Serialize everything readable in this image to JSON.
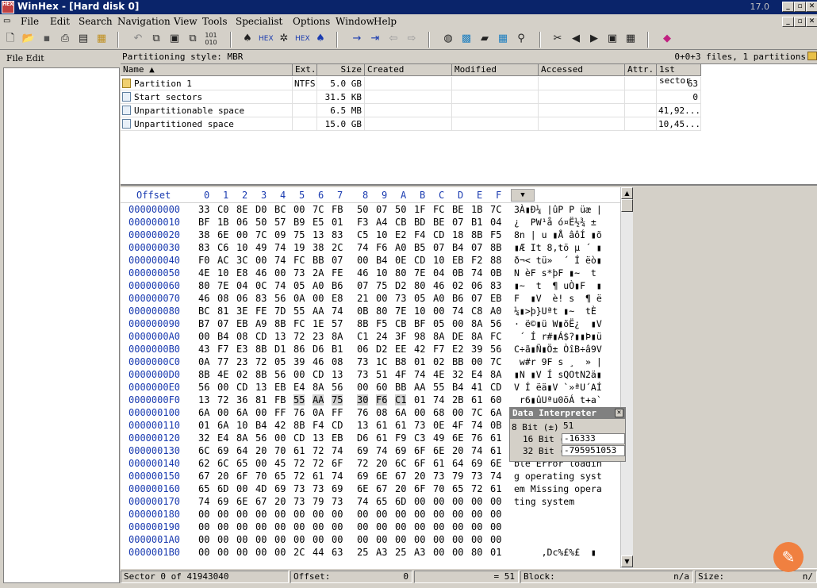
{
  "window": {
    "title": "WinHex - [Hard disk 0]",
    "version": "17.0"
  },
  "menu": [
    "File",
    "Edit",
    "Search",
    "Navigation",
    "View",
    "Tools",
    "Specialist",
    "Options",
    "Window",
    "Help"
  ],
  "toolbar_icons": [
    "new-icon",
    "open-icon",
    "save-icon",
    "print-icon",
    "properties-icon",
    "open-folder-icon",
    "undo-icon",
    "copy-icon",
    "paste-icon",
    "clipboard-icon",
    "binary-icon",
    "find-icon",
    "find-hex-icon",
    "replace-icon",
    "replace-hex-icon",
    "find-next-icon",
    "goto-icon",
    "goto-offset-icon",
    "back-icon",
    "forward-icon",
    "disk-icon",
    "ram-icon",
    "calculator-icon",
    "table-icon",
    "search-icon",
    "tools-icon",
    "prev-icon",
    "next-icon",
    "camera-icon",
    "grid-icon",
    "book-icon"
  ],
  "left_panel": {
    "menu": "File Edit"
  },
  "partition_info": {
    "style": "Partitioning style: MBR",
    "summary": "0+0+3 files, 1 partitions"
  },
  "file_list": {
    "columns": [
      "Name",
      "Ext.",
      "Size",
      "Created",
      "Modified",
      "Accessed",
      "Attr.",
      "1st sector"
    ],
    "rows": [
      {
        "name": "Partition 1",
        "ext": "NTFS",
        "size": "5.0 GB",
        "first": "63"
      },
      {
        "name": "Start sectors",
        "ext": "",
        "size": "31.5 KB",
        "first": "0"
      },
      {
        "name": "Unpartitionable space",
        "ext": "",
        "size": "6.5 MB",
        "first": "41,92..."
      },
      {
        "name": "Unpartitioned space",
        "ext": "",
        "size": "15.0 GB",
        "first": "10,45..."
      }
    ]
  },
  "hex": {
    "header": [
      "Offset",
      "0",
      "1",
      "2",
      "3",
      "4",
      "5",
      "6",
      "7",
      "8",
      "9",
      "A",
      "B",
      "C",
      "D",
      "E",
      "F"
    ],
    "rows": [
      {
        "off": "000000000",
        "bytes": [
          "33",
          "C0",
          "8E",
          "D0",
          "BC",
          "00",
          "7C",
          "FB",
          "50",
          "07",
          "50",
          "1F",
          "FC",
          "BE",
          "1B",
          "7C"
        ],
        "ascii": "3À▮Ð¼ |ûP P üæ |"
      },
      {
        "off": "000000010",
        "bytes": [
          "BF",
          "1B",
          "06",
          "50",
          "57",
          "B9",
          "E5",
          "01",
          "F3",
          "A4",
          "CB",
          "BD",
          "BE",
          "07",
          "B1",
          "04"
        ],
        "ascii": "¿  PW¹å ó¤Ë½¾ ±"
      },
      {
        "off": "000000020",
        "bytes": [
          "38",
          "6E",
          "00",
          "7C",
          "09",
          "75",
          "13",
          "83",
          "C5",
          "10",
          "E2",
          "F4",
          "CD",
          "18",
          "8B",
          "F5"
        ],
        "ascii": "8n | u ▮Å âôÍ ▮õ"
      },
      {
        "off": "000000030",
        "bytes": [
          "83",
          "C6",
          "10",
          "49",
          "74",
          "19",
          "38",
          "2C",
          "74",
          "F6",
          "A0",
          "B5",
          "07",
          "B4",
          "07",
          "8B"
        ],
        "ascii": "▮Æ It 8,tö µ ´ ▮"
      },
      {
        "off": "000000040",
        "bytes": [
          "F0",
          "AC",
          "3C",
          "00",
          "74",
          "FC",
          "BB",
          "07",
          "00",
          "B4",
          "0E",
          "CD",
          "10",
          "EB",
          "F2",
          "88"
        ],
        "ascii": "ð¬< tü»  ´ Í ëò▮"
      },
      {
        "off": "000000050",
        "bytes": [
          "4E",
          "10",
          "E8",
          "46",
          "00",
          "73",
          "2A",
          "FE",
          "46",
          "10",
          "80",
          "7E",
          "04",
          "0B",
          "74",
          "0B"
        ],
        "ascii": "N èF s*þF ▮~  t"
      },
      {
        "off": "000000060",
        "bytes": [
          "80",
          "7E",
          "04",
          "0C",
          "74",
          "05",
          "A0",
          "B6",
          "07",
          "75",
          "D2",
          "80",
          "46",
          "02",
          "06",
          "83"
        ],
        "ascii": "▮~  t  ¶ uÒ▮F  ▮"
      },
      {
        "off": "000000070",
        "bytes": [
          "46",
          "08",
          "06",
          "83",
          "56",
          "0A",
          "00",
          "E8",
          "21",
          "00",
          "73",
          "05",
          "A0",
          "B6",
          "07",
          "EB"
        ],
        "ascii": "F  ▮V  è! s  ¶ ë"
      },
      {
        "off": "000000080",
        "bytes": [
          "BC",
          "81",
          "3E",
          "FE",
          "7D",
          "55",
          "AA",
          "74",
          "0B",
          "80",
          "7E",
          "10",
          "00",
          "74",
          "C8",
          "A0"
        ],
        "ascii": "¼▮>þ}Uªt ▮~  tÈ "
      },
      {
        "off": "000000090",
        "bytes": [
          "B7",
          "07",
          "EB",
          "A9",
          "8B",
          "FC",
          "1E",
          "57",
          "8B",
          "F5",
          "CB",
          "BF",
          "05",
          "00",
          "8A",
          "56"
        ],
        "ascii": "· ë©▮ü W▮õË¿  ▮V"
      },
      {
        "off": "0000000A0",
        "bytes": [
          "00",
          "B4",
          "08",
          "CD",
          "13",
          "72",
          "23",
          "8A",
          "C1",
          "24",
          "3F",
          "98",
          "8A",
          "DE",
          "8A",
          "FC"
        ],
        "ascii": " ´ Í r#▮Á$?▮▮Þ▮ü"
      },
      {
        "off": "0000000B0",
        "bytes": [
          "43",
          "F7",
          "E3",
          "8B",
          "D1",
          "86",
          "D6",
          "B1",
          "06",
          "D2",
          "EE",
          "42",
          "F7",
          "E2",
          "39",
          "56"
        ],
        "ascii": "C÷ã▮Ñ▮Ö± ÒîB÷â9V"
      },
      {
        "off": "0000000C0",
        "bytes": [
          "0A",
          "77",
          "23",
          "72",
          "05",
          "39",
          "46",
          "08",
          "73",
          "1C",
          "B8",
          "01",
          "02",
          "BB",
          "00",
          "7C"
        ],
        "ascii": " w#r 9F s ¸  » |"
      },
      {
        "off": "0000000D0",
        "bytes": [
          "8B",
          "4E",
          "02",
          "8B",
          "56",
          "00",
          "CD",
          "13",
          "73",
          "51",
          "4F",
          "74",
          "4E",
          "32",
          "E4",
          "8A"
        ],
        "ascii": "▮N ▮V Í sQOtN2ä▮"
      },
      {
        "off": "0000000E0",
        "bytes": [
          "56",
          "00",
          "CD",
          "13",
          "EB",
          "E4",
          "8A",
          "56",
          "00",
          "60",
          "BB",
          "AA",
          "55",
          "B4",
          "41",
          "CD"
        ],
        "ascii": "V Í ëä▮V `»ªU´AÍ"
      },
      {
        "off": "0000000F0",
        "bytes": [
          "13",
          "72",
          "36",
          "81",
          "FB",
          "55",
          "AA",
          "75",
          "30",
          "F6",
          "C1",
          "01",
          "74",
          "2B",
          "61",
          "60"
        ],
        "ascii": " r6▮ûUªu0öÁ t+a`"
      },
      {
        "off": "000000100",
        "bytes": [
          "6A",
          "00",
          "6A",
          "00",
          "FF",
          "76",
          "0A",
          "FF",
          "76",
          "08",
          "6A",
          "00",
          "68",
          "00",
          "7C",
          "6A"
        ],
        "ascii": ""
      },
      {
        "off": "000000110",
        "bytes": [
          "01",
          "6A",
          "10",
          "B4",
          "42",
          "8B",
          "F4",
          "CD",
          "13",
          "61",
          "61",
          "73",
          "0E",
          "4F",
          "74",
          "0B"
        ],
        "ascii": ""
      },
      {
        "off": "000000120",
        "bytes": [
          "32",
          "E4",
          "8A",
          "56",
          "00",
          "CD",
          "13",
          "EB",
          "D6",
          "61",
          "F9",
          "C3",
          "49",
          "6E",
          "76",
          "61"
        ],
        "ascii": ""
      },
      {
        "off": "000000130",
        "bytes": [
          "6C",
          "69",
          "64",
          "20",
          "70",
          "61",
          "72",
          "74",
          "69",
          "74",
          "69",
          "6F",
          "6E",
          "20",
          "74",
          "61"
        ],
        "ascii": ""
      },
      {
        "off": "000000140",
        "bytes": [
          "62",
          "6C",
          "65",
          "00",
          "45",
          "72",
          "72",
          "6F",
          "72",
          "20",
          "6C",
          "6F",
          "61",
          "64",
          "69",
          "6E"
        ],
        "ascii": "ble Error loadin"
      },
      {
        "off": "000000150",
        "bytes": [
          "67",
          "20",
          "6F",
          "70",
          "65",
          "72",
          "61",
          "74",
          "69",
          "6E",
          "67",
          "20",
          "73",
          "79",
          "73",
          "74"
        ],
        "ascii": "g operating syst"
      },
      {
        "off": "000000160",
        "bytes": [
          "65",
          "6D",
          "00",
          "4D",
          "69",
          "73",
          "73",
          "69",
          "6E",
          "67",
          "20",
          "6F",
          "70",
          "65",
          "72",
          "61"
        ],
        "ascii": "em Missing opera"
      },
      {
        "off": "000000170",
        "bytes": [
          "74",
          "69",
          "6E",
          "67",
          "20",
          "73",
          "79",
          "73",
          "74",
          "65",
          "6D",
          "00",
          "00",
          "00",
          "00",
          "00"
        ],
        "ascii": "ting system"
      },
      {
        "off": "000000180",
        "bytes": [
          "00",
          "00",
          "00",
          "00",
          "00",
          "00",
          "00",
          "00",
          "00",
          "00",
          "00",
          "00",
          "00",
          "00",
          "00",
          "00"
        ],
        "ascii": ""
      },
      {
        "off": "000000190",
        "bytes": [
          "00",
          "00",
          "00",
          "00",
          "00",
          "00",
          "00",
          "00",
          "00",
          "00",
          "00",
          "00",
          "00",
          "00",
          "00",
          "00"
        ],
        "ascii": ""
      },
      {
        "off": "0000001A0",
        "bytes": [
          "00",
          "00",
          "00",
          "00",
          "00",
          "00",
          "00",
          "00",
          "00",
          "00",
          "00",
          "00",
          "00",
          "00",
          "00",
          "00"
        ],
        "ascii": ""
      },
      {
        "off": "0000001B0",
        "bytes": [
          "00",
          "00",
          "00",
          "00",
          "00",
          "2C",
          "44",
          "63",
          "25",
          "A3",
          "25",
          "A3",
          "00",
          "00",
          "80",
          "01"
        ],
        "ascii": "     ,Dc%£%£  ▮"
      }
    ]
  },
  "data_interpreter": {
    "title": "Data Interpreter",
    "rows": [
      {
        "label": "8 Bit (±)",
        "value": "51"
      },
      {
        "label": "16 Bit (",
        "value": "-16333"
      },
      {
        "label": "32 Bit (",
        "value": "-795951053"
      }
    ]
  },
  "status": {
    "sector": "Sector 0 of 41943040",
    "offset_label": "Offset:",
    "offset_value": "0",
    "value": "= 51",
    "block_label": "Block:",
    "block_value": "n/a",
    "size_label": "Size:",
    "size_value": "n/"
  }
}
